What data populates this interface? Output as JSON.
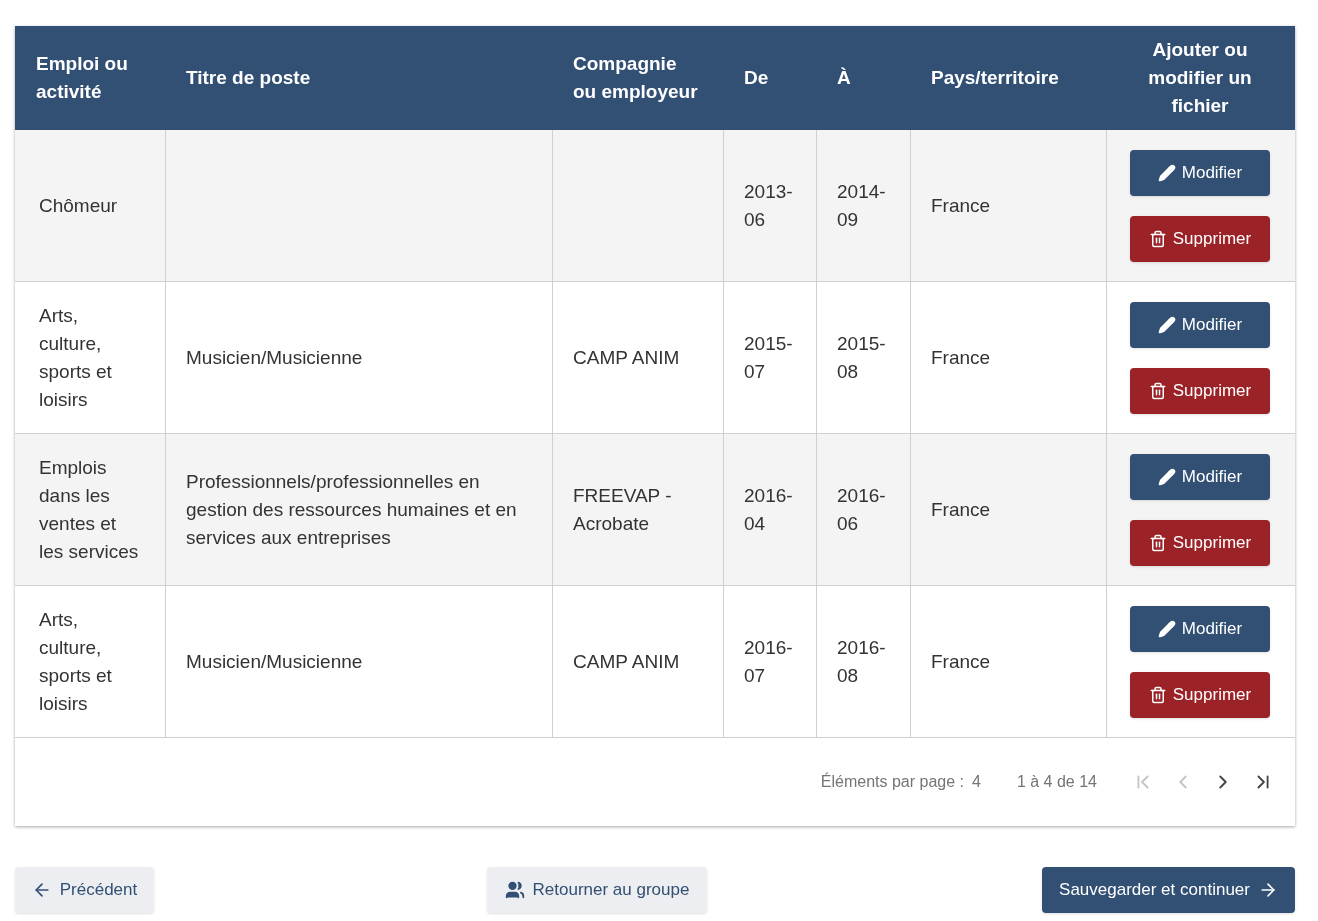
{
  "table": {
    "columns": [
      "Emploi ou activité",
      "Titre de poste",
      "Compagnie ou employeur",
      "De",
      "À",
      "Pays/territoire",
      "Ajouter ou modifier un fichier"
    ],
    "rows": [
      {
        "activity": "Chômeur",
        "title": "",
        "company": "",
        "from": "2013-06",
        "to": "2014-09",
        "country": "France",
        "edit": "Modifier",
        "delete": "Supprimer"
      },
      {
        "activity": "Arts, culture, sports et loisirs",
        "title": "Musicien/Musicienne",
        "company": "CAMP ANIM",
        "from": "2015-07",
        "to": "2015-08",
        "country": "France",
        "edit": "Modifier",
        "delete": "Supprimer"
      },
      {
        "activity": "Emplois dans les ventes et les services",
        "title": "Professionnels/professionnelles en gestion des ressources humaines et en services aux entreprises",
        "company": "FREEVAP - Acrobate",
        "from": "2016-04",
        "to": "2016-06",
        "country": "France",
        "edit": "Modifier",
        "delete": "Supprimer"
      },
      {
        "activity": "Arts, culture, sports et loisirs",
        "title": "Musicien/Musicienne",
        "company": "CAMP ANIM",
        "from": "2016-07",
        "to": "2016-08",
        "country": "France",
        "edit": "Modifier",
        "delete": "Supprimer"
      }
    ]
  },
  "paginator": {
    "items_per_page_label": "Éléments par page :",
    "items_per_page": "4",
    "range": "1 à 4 de 14",
    "buttons": [
      {
        "kind": "first",
        "disabled": true
      },
      {
        "kind": "previous",
        "disabled": true
      },
      {
        "kind": "next",
        "disabled": false
      },
      {
        "kind": "last",
        "disabled": false
      }
    ]
  },
  "actions": {
    "previous": "Précédent",
    "back_to_group": "Retourner au groupe",
    "save": "Sauvegarder et continuer"
  }
}
